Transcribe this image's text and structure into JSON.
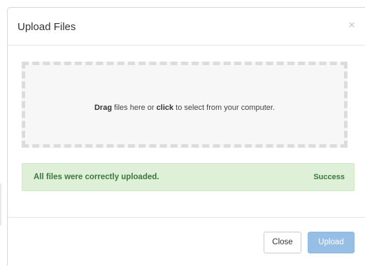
{
  "dialog": {
    "title": "Upload Files",
    "close_icon": "×"
  },
  "dropzone": {
    "text_bold_1": "Drag",
    "text_middle": " files here or ",
    "text_bold_2": "click",
    "text_end": " to select from your computer."
  },
  "alert": {
    "message": "All files were correctly uploaded.",
    "status": "Success",
    "colors": {
      "background": "#dff0d8",
      "text": "#3c763d"
    }
  },
  "footer": {
    "close_label": "Close",
    "upload_label": "Upload",
    "colors": {
      "upload_button": "#97bfe6"
    }
  }
}
